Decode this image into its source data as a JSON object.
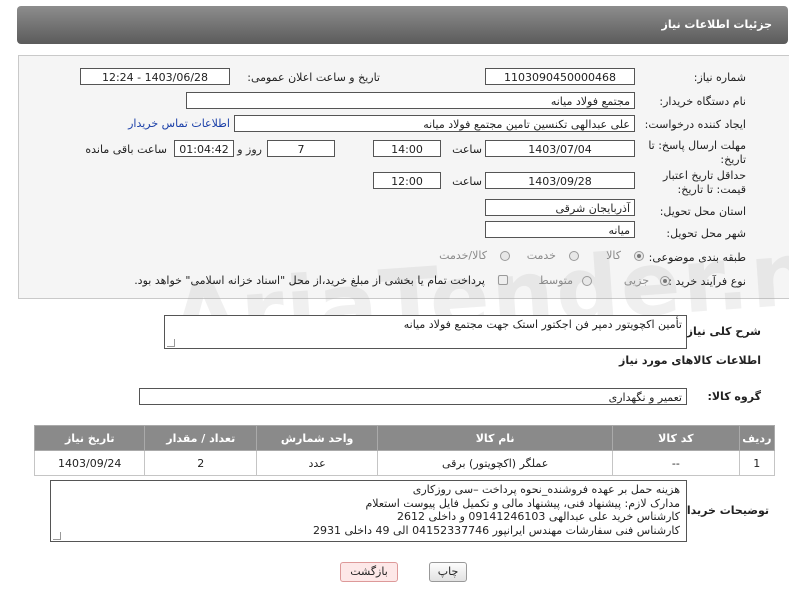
{
  "header": {
    "title": "جزئیات اطلاعات نیاز"
  },
  "form": {
    "need_number": {
      "label": "شماره نیاز:",
      "value": "1103090450000468"
    },
    "announce": {
      "label": "تاریخ و ساعت اعلان عمومی:",
      "value": "1403/06/28 - 12:24"
    },
    "buyer_org": {
      "label": "نام دستگاه خریدار:",
      "value": "مجتمع فولاد میانه"
    },
    "requester": {
      "label": "ایجاد کننده درخواست:",
      "value": "علی عبدالهی تکنسین تامین مجتمع فولاد میانه",
      "link": "اطلاعات تماس خریدار"
    },
    "deadline": {
      "label": "مهلت ارسال پاسخ: تا تاریخ:",
      "date": "1403/07/04",
      "time_label": "ساعت",
      "time": "14:00",
      "days": "7",
      "days_label": "روز و",
      "remaining": "01:04:42",
      "remaining_label": "ساعت باقی مانده"
    },
    "validity": {
      "label": "حداقل تاریخ اعتبار قیمت: تا تاریخ:",
      "date": "1403/09/28",
      "time_label": "ساعت",
      "time": "12:00"
    },
    "province": {
      "label": "استان محل تحویل:",
      "value": "آذربایجان شرقی"
    },
    "city": {
      "label": "شهر محل تحویل:",
      "value": "میانه"
    },
    "category": {
      "label": "طبقه بندی موضوعی:",
      "options": [
        "کالا",
        "خدمت",
        "کالا/خدمت"
      ]
    },
    "process": {
      "label": "نوع فرآیند خرید :",
      "options": [
        "جزیی",
        "متوسط"
      ],
      "payment_note": "پرداخت تمام یا بخشی از مبلغ خرید،از محل \"اسناد خزانه اسلامی\" خواهد بود."
    }
  },
  "summary": {
    "label": "شرح کلی نیاز:",
    "value": "تأمین اکچویتور دمپر فن اجکتور استک جهت مجتمع فولاد میانه"
  },
  "goods_info": {
    "title": "اطلاعات کالاهای مورد نیاز"
  },
  "goods_group": {
    "label": "گروه کالا:",
    "value": "تعمیر و نگهداری"
  },
  "table": {
    "headers": [
      "ردیف",
      "کد کالا",
      "نام کالا",
      "واحد شمارش",
      "تعداد / مقدار",
      "تاریخ نیاز"
    ],
    "rows": [
      [
        "1",
        "--",
        "عملگر (اکچویتور) برقی",
        "عدد",
        "2",
        "1403/09/24"
      ]
    ]
  },
  "buyer_notes": {
    "label": "توضیحات خریدار:",
    "lines": [
      "هزینه حمل بر عهده فروشنده_نحوه پرداخت –سی روزکاری",
      "مدارک لازم: پیشنهاد فنی، پیشنهاد مالی و تکمیل فایل پیوست استعلام",
      "کارشناس خرید علی عبدالهی 09141246103 و داخلی 2612",
      "کارشناس فنی سفارشات مهندس ایرانپور 04152337746 الی 49 داخلی 2931"
    ]
  },
  "buttons": {
    "print": "چاپ",
    "back": "بازگشت"
  },
  "watermark": "AriaTender.net",
  "colors": {
    "header_bg": "#6e6e6e",
    "link": "#1a3fa8",
    "back_button_bg": "#fde8e8"
  }
}
